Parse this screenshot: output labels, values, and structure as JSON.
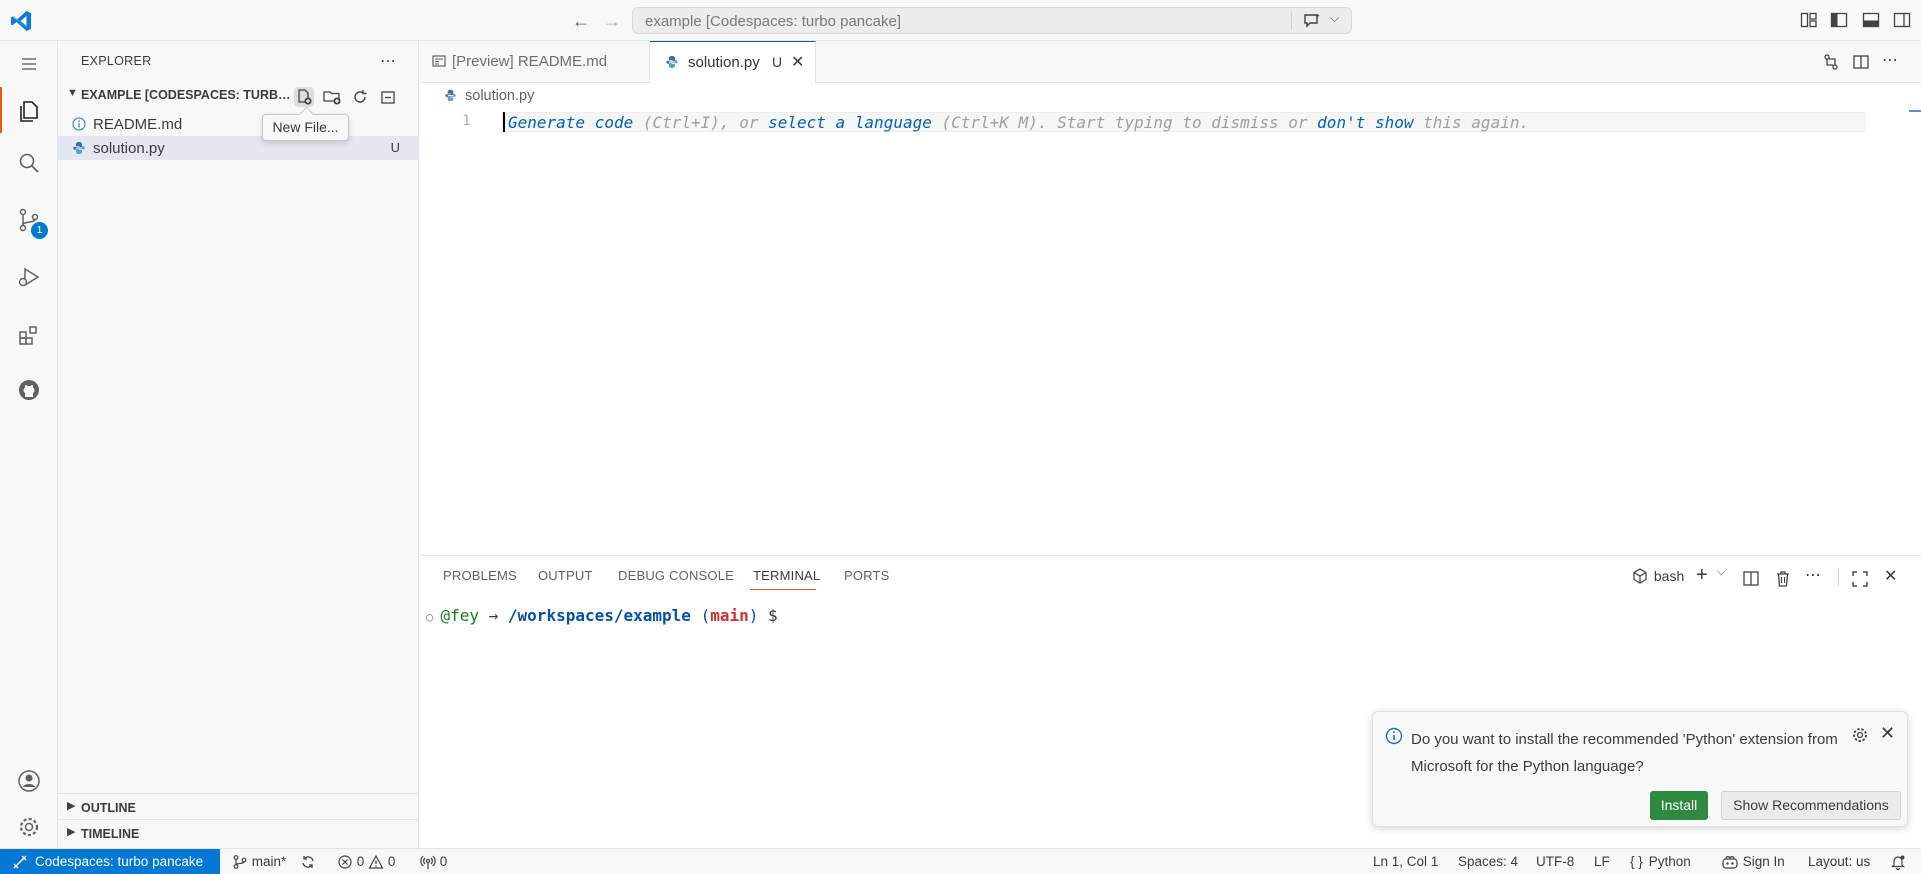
{
  "titlebar": {
    "search_text": "example [Codespaces: turbo pancake]"
  },
  "activitybar": {
    "scm_badge": "1"
  },
  "sidebar": {
    "title": "EXPLORER",
    "folder_name": "EXAMPLE [CODESPACES: TURBO PANCAKE]",
    "files": [
      {
        "name": "README.md",
        "icon": "info-icon",
        "badge": ""
      },
      {
        "name": "solution.py",
        "icon": "python-icon",
        "badge": "U"
      }
    ],
    "tooltip": "New File...",
    "sections": [
      "OUTLINE",
      "TIMELINE"
    ]
  },
  "tabs": [
    {
      "label": "[Preview] README.md",
      "icon": "preview-icon",
      "modified": ""
    },
    {
      "label": "solution.py",
      "icon": "python-icon",
      "modified": "U"
    }
  ],
  "breadcrumb": {
    "file": "solution.py"
  },
  "editor": {
    "line_number": "1",
    "hint": {
      "generate_code": "Generate code",
      "part1": " (Ctrl+I), or ",
      "select_language": "select a language",
      "part2": " (Ctrl+K M). Start typing to dismiss or ",
      "dont_show": "don't show",
      "part3": " this again."
    }
  },
  "panel": {
    "tabs": [
      "PROBLEMS",
      "OUTPUT",
      "DEBUG CONSOLE",
      "TERMINAL",
      "PORTS"
    ],
    "active_tab": "TERMINAL",
    "shell": "bash",
    "terminal": {
      "user": "@fey",
      "arrow": "→",
      "path": "/workspaces/example",
      "branch_open": "(",
      "branch": "main",
      "branch_close": ")",
      "prompt": "$"
    }
  },
  "notification": {
    "message": "Do you want to install the recommended 'Python' extension from Microsoft for the Python language?",
    "install_label": "Install",
    "recommend_label": "Show Recommendations"
  },
  "statusbar": {
    "remote": "Codespaces: turbo pancake",
    "branch": "main*",
    "errors": "0",
    "warnings": "0",
    "ports": "0",
    "position": "Ln 1, Col 1",
    "spaces": "Spaces: 4",
    "encoding": "UTF-8",
    "eol": "LF",
    "language": "Python",
    "sign_in": "Sign In",
    "layout": "Layout: us"
  },
  "colors": {
    "accent": "#0078d4",
    "install": "#2d8a3e",
    "terminal_user": "#118020",
    "terminal_path": "#0451a5",
    "terminal_branch": "#cd3131"
  }
}
